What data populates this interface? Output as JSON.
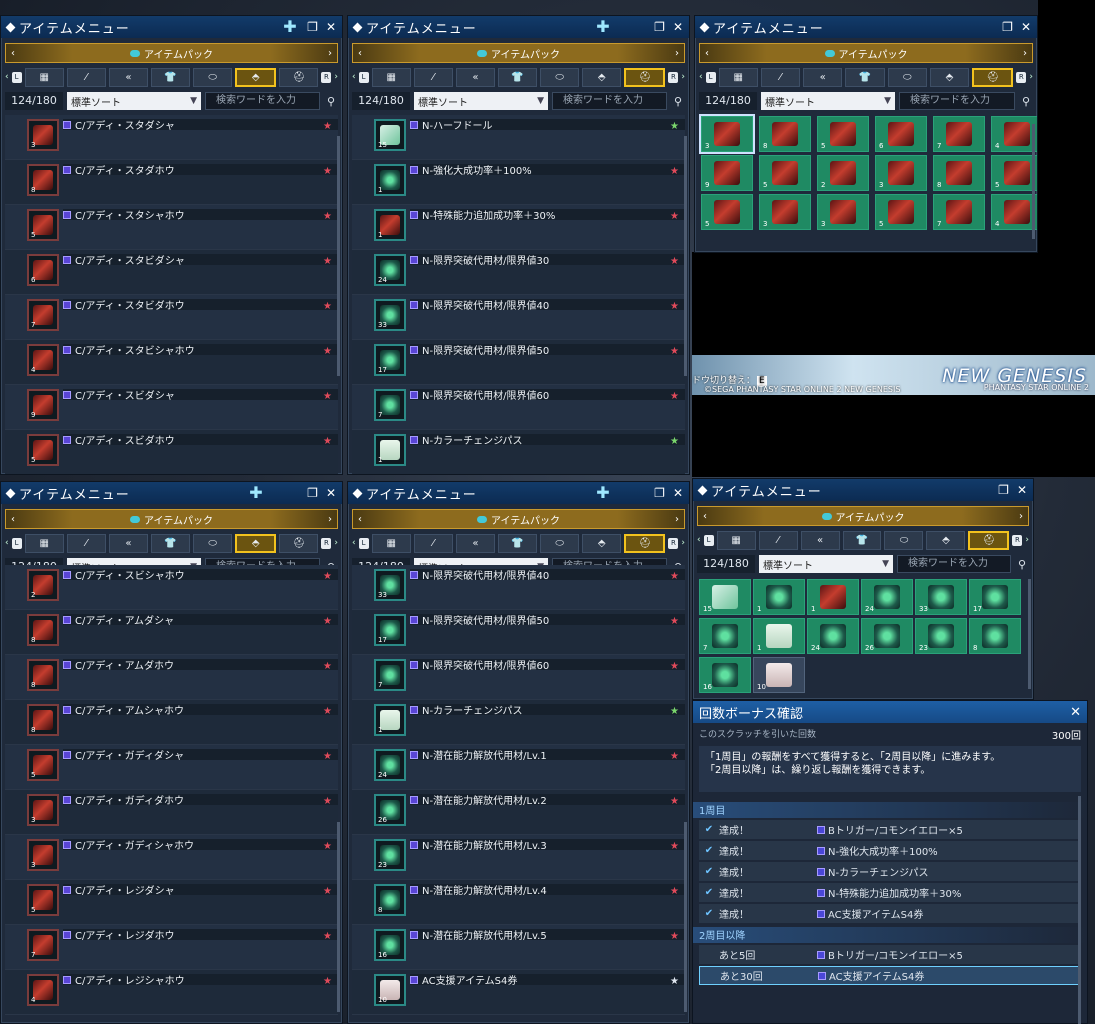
{
  "menu_title": "アイテムメニュー",
  "pack_label": "アイテムパック",
  "count": "124/180",
  "sort_label": "標準ソート",
  "search_placeholder": "検索ワードを入力",
  "tab_icons": [
    "grid-icon",
    "sword-icon",
    "wing-icon",
    "shirt-icon",
    "capsule-icon",
    "diamond-box-icon",
    "bag-icon"
  ],
  "colors": {
    "title": "#0c2b52",
    "pack": "#8d6b1e",
    "selected_tab": "#f2c21e",
    "grid_cell": "#1f8a63",
    "rarity": "#5a45d6"
  },
  "w1": {
    "items": [
      {
        "name": "C/アディ・スタダシャ",
        "qty": "3"
      },
      {
        "name": "C/アディ・スタダホウ",
        "qty": "8"
      },
      {
        "name": "C/アディ・スタシャホウ",
        "qty": "5"
      },
      {
        "name": "C/アディ・スタビダシャ",
        "qty": "6"
      },
      {
        "name": "C/アディ・スタビダホウ",
        "qty": "7"
      },
      {
        "name": "C/アディ・スタビシャホウ",
        "qty": "4"
      },
      {
        "name": "C/アディ・スビダシャ",
        "qty": "9"
      },
      {
        "name": "C/アディ・スビダホウ",
        "qty": "5"
      }
    ]
  },
  "w2": {
    "items": [
      {
        "name": "N-ハーフドール",
        "qty": "15",
        "kind": "white",
        "star": "grn"
      },
      {
        "name": "N-強化大成功率＋100%",
        "qty": "1",
        "kind": "green",
        "star": "red"
      },
      {
        "name": "N-特殊能力追加成功率＋30%",
        "qty": "1",
        "kind": "red",
        "star": "red"
      },
      {
        "name": "N-限界突破代用材/限界値30",
        "qty": "24",
        "kind": "green",
        "star": "red"
      },
      {
        "name": "N-限界突破代用材/限界値40",
        "qty": "33",
        "kind": "green",
        "star": "red"
      },
      {
        "name": "N-限界突破代用材/限界値50",
        "qty": "17",
        "kind": "green",
        "star": "red"
      },
      {
        "name": "N-限界突破代用材/限界値60",
        "qty": "7",
        "kind": "green",
        "star": "red"
      },
      {
        "name": "N-カラーチェンジパス",
        "qty": "1",
        "kind": "card",
        "star": "grn"
      }
    ]
  },
  "w3": {
    "cells": [
      "3",
      "8",
      "5",
      "6",
      "7",
      "4",
      "9",
      "5",
      "2",
      "3",
      "8",
      "5",
      "5",
      "3",
      "3",
      "5",
      "7",
      "4"
    ]
  },
  "w4": {
    "items": [
      {
        "name": "C/アディ・スビシャホウ",
        "qty": "2"
      },
      {
        "name": "C/アディ・アムダシャ",
        "qty": "8"
      },
      {
        "name": "C/アディ・アムダホウ",
        "qty": "8"
      },
      {
        "name": "C/アディ・アムシャホウ",
        "qty": "8"
      },
      {
        "name": "C/アディ・ガディダシャ",
        "qty": "5"
      },
      {
        "name": "C/アディ・ガディダホウ",
        "qty": "3"
      },
      {
        "name": "C/アディ・ガディシャホウ",
        "qty": "3"
      },
      {
        "name": "C/アディ・レジダシャ",
        "qty": "5"
      },
      {
        "name": "C/アディ・レジダホウ",
        "qty": "7"
      },
      {
        "name": "C/アディ・レジシャホウ",
        "qty": "4"
      }
    ]
  },
  "w5": {
    "items": [
      {
        "name": "N-限界突破代用材/限界値40",
        "qty": "33",
        "kind": "green",
        "star": "red"
      },
      {
        "name": "N-限界突破代用材/限界値50",
        "qty": "17",
        "kind": "green",
        "star": "red"
      },
      {
        "name": "N-限界突破代用材/限界値60",
        "qty": "7",
        "kind": "green",
        "star": "red"
      },
      {
        "name": "N-カラーチェンジパス",
        "qty": "1",
        "kind": "card",
        "star": "grn"
      },
      {
        "name": "N-潜在能力解放代用材/Lv.1",
        "qty": "24",
        "kind": "green",
        "star": "red"
      },
      {
        "name": "N-潜在能力解放代用材/Lv.2",
        "qty": "26",
        "kind": "green",
        "star": "red"
      },
      {
        "name": "N-潜在能力解放代用材/Lv.3",
        "qty": "23",
        "kind": "green",
        "star": "red"
      },
      {
        "name": "N-潜在能力解放代用材/Lv.4",
        "qty": "8",
        "kind": "green",
        "star": "red"
      },
      {
        "name": "N-潜在能力解放代用材/Lv.5",
        "qty": "16",
        "kind": "green",
        "star": "red"
      },
      {
        "name": "AC支援アイテムS4券",
        "qty": "10",
        "kind": "ticket",
        "star": "wht"
      }
    ]
  },
  "w6": {
    "cells": [
      {
        "qty": "15",
        "kind": "white"
      },
      {
        "qty": "1",
        "kind": "green"
      },
      {
        "qty": "1",
        "kind": "red"
      },
      {
        "qty": "24",
        "kind": "green"
      },
      {
        "qty": "33",
        "kind": "green"
      },
      {
        "qty": "17",
        "kind": "green"
      },
      {
        "qty": "7",
        "kind": "green"
      },
      {
        "qty": "1",
        "kind": "card"
      },
      {
        "qty": "24",
        "kind": "green"
      },
      {
        "qty": "26",
        "kind": "green"
      },
      {
        "qty": "23",
        "kind": "green"
      },
      {
        "qty": "8",
        "kind": "green"
      },
      {
        "qty": "16",
        "kind": "green"
      },
      {
        "qty": "10",
        "kind": "ticket"
      }
    ]
  },
  "banner": {
    "logo": "NEW GENESIS",
    "sub": "PHANTASY STAR ONLINE 2",
    "copyright": "©SEGA PHANTASY STAR ONLINE 2 NEW GENESIS",
    "toggle": "ドウ切り替え：",
    "toggle_key": "E"
  },
  "bonus": {
    "title": "回数ボーナス確認",
    "draw_label": "このスクラッチを引いた回数",
    "draw_count": "300回",
    "desc1": "「1周目」の報酬をすべて獲得すると、「2周目以降」に進みます。",
    "desc2": "「2周目以降」は、繰り返し報酬を獲得できます。",
    "sec1": "1周目",
    "sec2": "2周目以降",
    "rows1": [
      {
        "status": "達成！",
        "reward": "Bトリガー/コモンイエロー×5"
      },
      {
        "status": "達成！",
        "reward": "N-強化大成功率＋100%"
      },
      {
        "status": "達成！",
        "reward": "N-カラーチェンジパス"
      },
      {
        "status": "達成！",
        "reward": "N-特殊能力追加成功率＋30%"
      },
      {
        "status": "達成！",
        "reward": "AC支援アイテムS4券"
      }
    ],
    "rows2": [
      {
        "status": "あと5回",
        "reward": "Bトリガー/コモンイエロー×5"
      },
      {
        "status": "あと30回",
        "reward": "AC支援アイテムS4券"
      }
    ]
  }
}
